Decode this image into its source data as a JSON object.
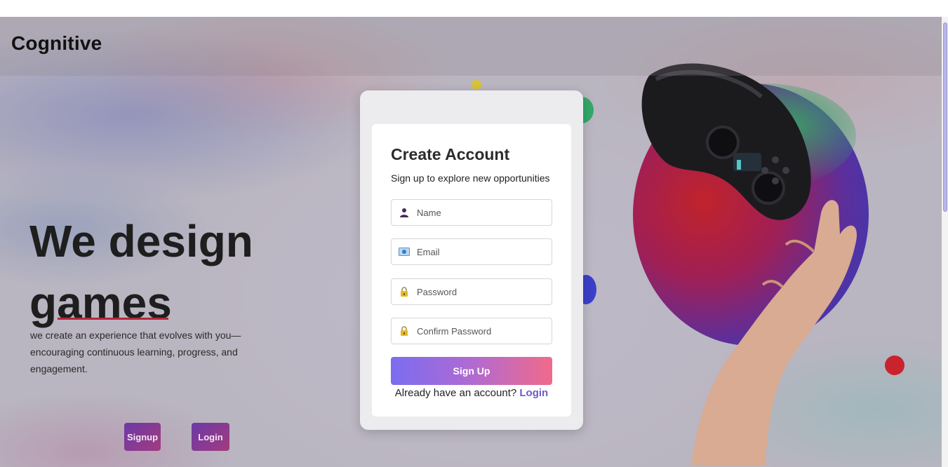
{
  "brand": {
    "name": "Cognitive"
  },
  "hero": {
    "title_line1": "We design",
    "title_line2": "games",
    "description": "we create an experience that evolves with you—encouraging continuous learning, progress, and engagement.",
    "signup_label": "Signup",
    "login_label": "Login"
  },
  "form": {
    "title": "Create Account",
    "subtitle": "Sign up to explore new opportunities",
    "fields": [
      {
        "placeholder": "Name",
        "icon": "person-icon"
      },
      {
        "placeholder": "Email",
        "icon": "email-icon"
      },
      {
        "placeholder": "Password",
        "icon": "lock-icon"
      },
      {
        "placeholder": "Confirm Password",
        "icon": "lock-icon"
      }
    ],
    "submit_label": "Sign Up",
    "already_text": "Already have an account?",
    "login_link": "Login"
  },
  "colors": {
    "accent_gradient_start": "#7b6cf0",
    "accent_gradient_end": "#f06a8a",
    "link": "#6a5acd",
    "hero_underline": "#b3283a"
  }
}
